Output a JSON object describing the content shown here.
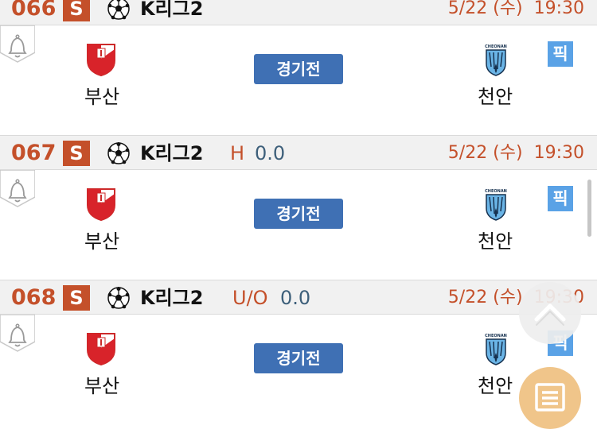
{
  "games": [
    {
      "number": "066",
      "badge": "S",
      "league": "K리그2",
      "handicap_label": "",
      "handicap_value": "",
      "date": "5/22 (수)",
      "time": "19:30",
      "home": "부산",
      "away": "천안",
      "status": "경기전",
      "pick": "픽"
    },
    {
      "number": "067",
      "badge": "S",
      "league": "K리그2",
      "handicap_label": "H",
      "handicap_value": "0.0",
      "date": "5/22 (수)",
      "time": "19:30",
      "home": "부산",
      "away": "천안",
      "status": "경기전",
      "pick": "픽"
    },
    {
      "number": "068",
      "badge": "S",
      "league": "K리그2",
      "handicap_label": "U/O",
      "handicap_value": "0.0",
      "date": "5/22 (수)",
      "time": "19:30",
      "home": "부산",
      "away": "천안",
      "status": "경기전",
      "pick": "픽"
    }
  ],
  "colors": {
    "accent": "#c4502a",
    "status_button": "#3f70b4",
    "pick": "#5aa2e6",
    "fab_menu": "#f0c58a"
  },
  "icons": {
    "alarm": "bell-icon",
    "sport": "soccer-ball-icon",
    "scroll_top": "chevron-up-icon",
    "menu": "list-icon"
  }
}
